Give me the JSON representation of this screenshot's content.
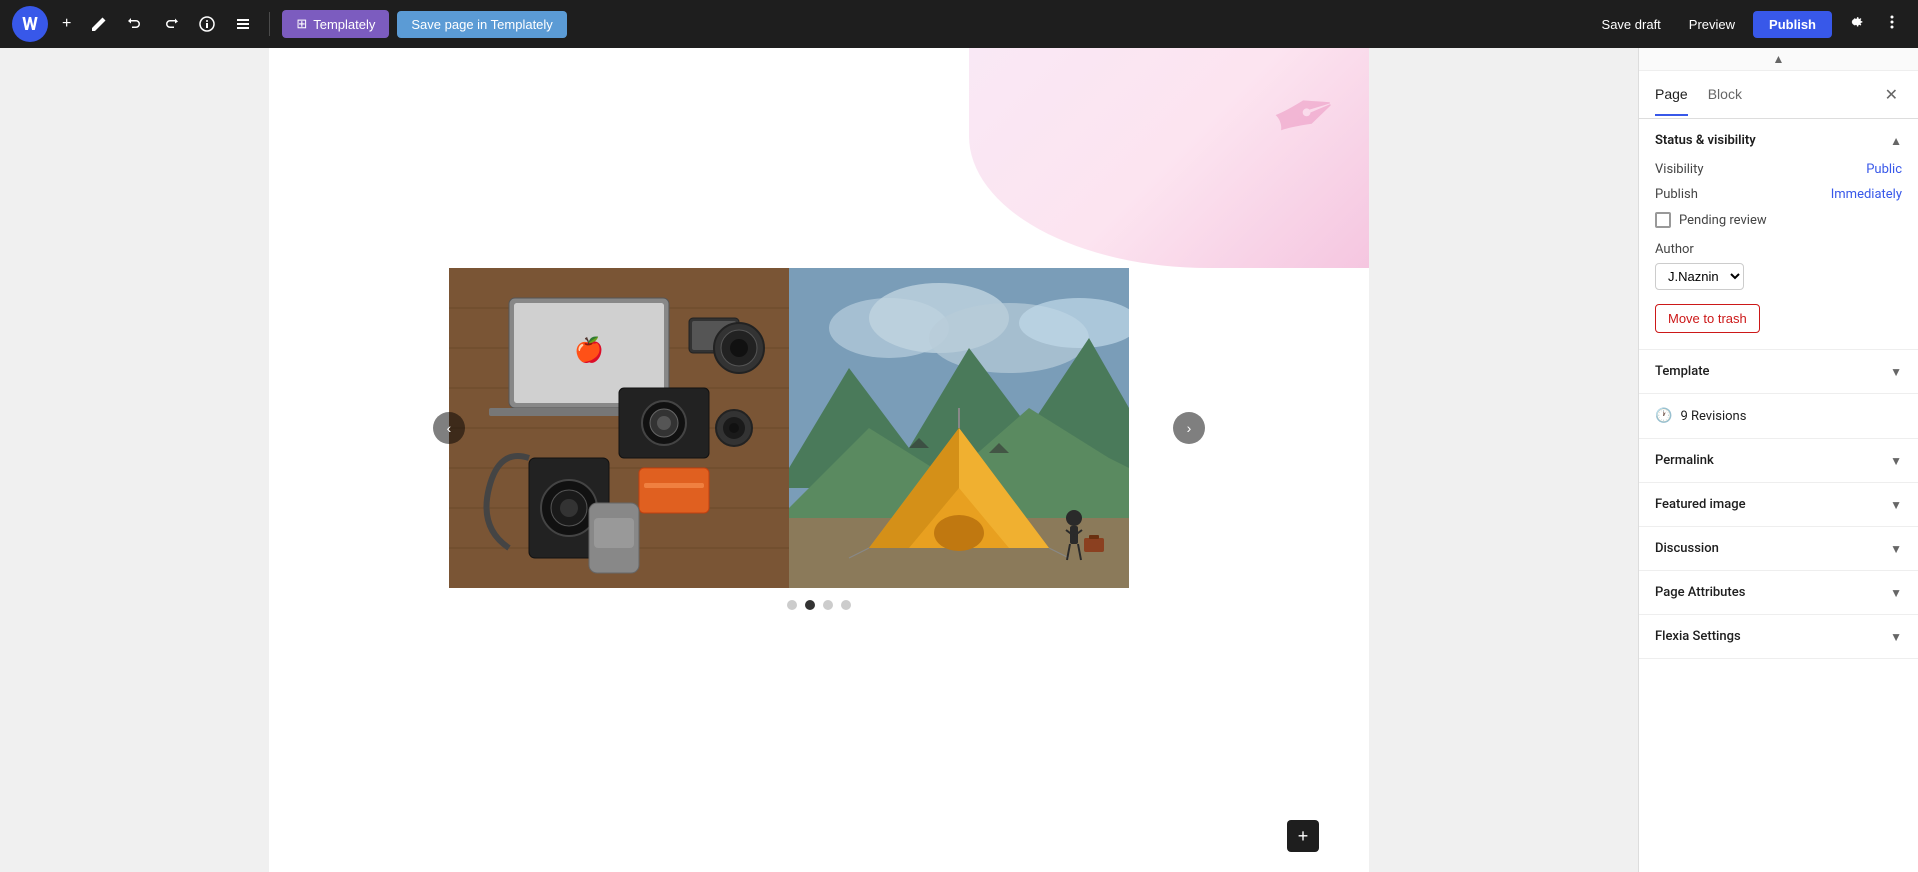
{
  "toolbar": {
    "wp_logo": "W",
    "add_btn": "+",
    "edit_icon": "✏",
    "undo_icon": "↩",
    "redo_icon": "↪",
    "info_icon": "ℹ",
    "list_icon": "≡",
    "templately_btn": "Templately",
    "save_templately_btn": "Save page in Templately",
    "save_draft_btn": "Save draft",
    "preview_btn": "Preview",
    "publish_btn": "Publish",
    "settings_icon": "⚙",
    "more_icon": "⋮"
  },
  "sidebar": {
    "tab_page": "Page",
    "tab_block": "Block",
    "close_icon": "✕",
    "scroll_up_icon": "▲",
    "sections": {
      "status_visibility": {
        "title": "Status & visibility",
        "toggle_icon": "▲",
        "visibility_label": "Visibility",
        "visibility_value": "Public",
        "publish_label": "Publish",
        "publish_value": "Immediately",
        "pending_review_label": "Pending review",
        "author_label": "Author",
        "author_value": "J.Naznin",
        "move_to_trash_label": "Move to trash"
      },
      "template": {
        "title": "Template",
        "toggle_icon": "▼"
      },
      "revisions": {
        "icon": "🕐",
        "count": "9",
        "label": "Revisions"
      },
      "permalink": {
        "title": "Permalink",
        "toggle_icon": "▼"
      },
      "featured_image": {
        "title": "Featured image",
        "toggle_icon": "▼"
      },
      "discussion": {
        "title": "Discussion",
        "toggle_icon": "▼"
      },
      "page_attributes": {
        "title": "Page Attributes",
        "toggle_icon": "▼"
      },
      "flexia_settings": {
        "title": "Flexia Settings",
        "toggle_icon": "▼"
      }
    }
  },
  "carousel": {
    "prev_icon": "‹",
    "next_icon": "›",
    "dots": [
      {
        "active": false
      },
      {
        "active": true
      },
      {
        "active": false
      },
      {
        "active": false
      }
    ],
    "add_block_icon": "+"
  },
  "colors": {
    "accent_blue": "#3858e9",
    "trash_red": "#cc1818",
    "link_blue": "#3858e9"
  }
}
